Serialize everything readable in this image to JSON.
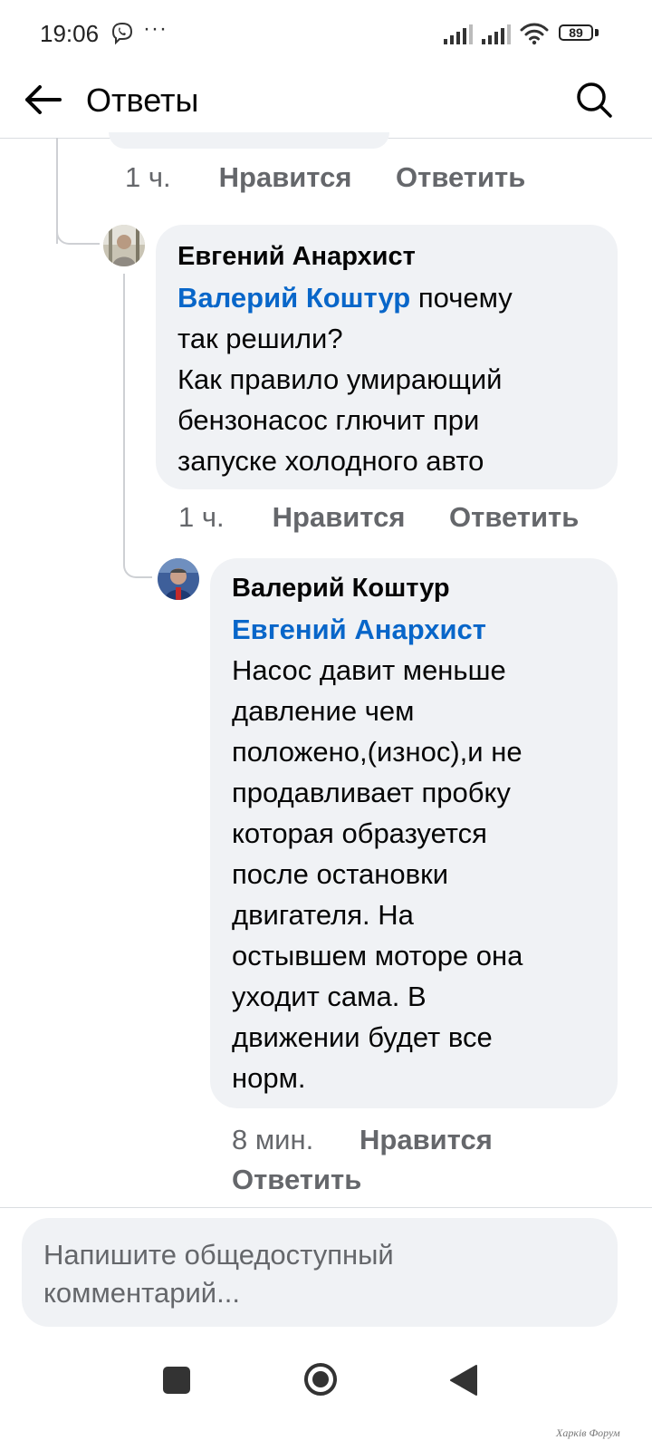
{
  "status_bar": {
    "time": "19:06",
    "more": "···",
    "battery": "89",
    "icons": [
      "viber-icon",
      "signal-icon",
      "signal-icon",
      "wifi-icon",
      "battery-icon"
    ]
  },
  "header": {
    "title": "Ответы",
    "back_icon": "arrow-left-icon",
    "search_icon": "search-icon"
  },
  "previous_comment": {
    "time": "1 ч.",
    "like": "Нравится",
    "reply": "Ответить"
  },
  "comments": [
    {
      "author": "Евгений Анархист",
      "mention": "Валерий Коштур",
      "text_line1": " почему",
      "text_rest": [
        "так решили?",
        "Как правило умирающий",
        "бензонасос глючит при",
        "запуске холодного авто"
      ],
      "time": "1 ч.",
      "like": "Нравится",
      "reply": "Ответить"
    },
    {
      "author": "Валерий Коштур",
      "mention": "Евгений Анархист",
      "text_lines": [
        "Насос давит меньше",
        "давление чем",
        "положено,(износ),и не",
        "продавливает пробку",
        "которая образуется",
        "после остановки",
        "двигателя. На",
        "остывшем моторе она",
        "уходит сама. В",
        "движении будет все",
        "норм."
      ],
      "time": "8 мин.",
      "like": "Нравится",
      "reply": "Ответить"
    }
  ],
  "composer": {
    "placeholder_line1": "Напишите общедоступный",
    "placeholder_line2": "комментарий..."
  },
  "nav_bar": {
    "icons": [
      "recent-apps-icon",
      "home-icon",
      "back-triangle-icon"
    ]
  },
  "watermark": "Харків Форум",
  "colors": {
    "mention": "#0866c9",
    "bubble": "#f0f2f5",
    "meta": "#65676b",
    "text": "#050505"
  }
}
